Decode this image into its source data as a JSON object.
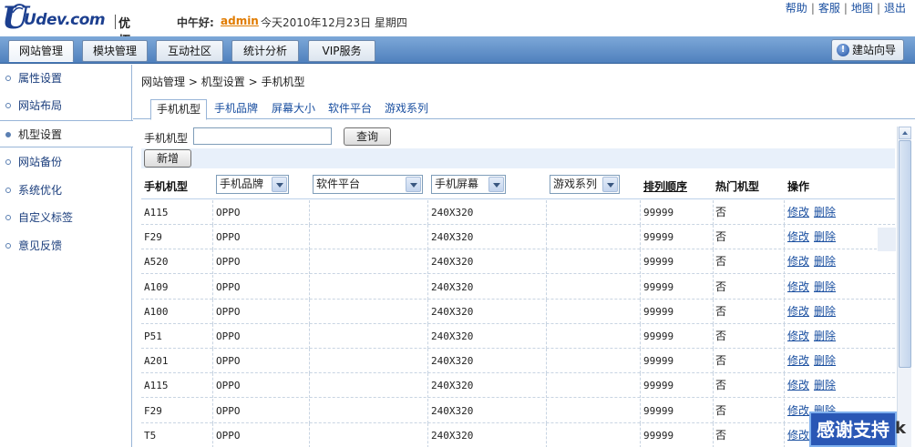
{
  "header": {
    "logo_text": "Udev.com",
    "logo_cn": "优拓",
    "greeting": "中午好:",
    "username": "admin",
    "date_text": "今天2010年12月23日 星期四",
    "top_links": [
      "帮助",
      "客服",
      "地图",
      "退出"
    ]
  },
  "nav": {
    "tabs": [
      "网站管理",
      "模块管理",
      "互动社区",
      "统计分析",
      "VIP服务"
    ],
    "active_tab": "网站管理",
    "wizard_label": "建站向导"
  },
  "sidebar": {
    "items": [
      "属性设置",
      "网站布局",
      "机型设置",
      "网站备份",
      "系统优化",
      "自定义标签",
      "意见反馈"
    ],
    "active": "机型设置"
  },
  "breadcrumb": [
    "网站管理",
    ">",
    "机型设置",
    ">",
    "手机机型"
  ],
  "subtabs": {
    "items": [
      "手机机型",
      "手机品牌",
      "屏幕大小",
      "软件平台",
      "游戏系列"
    ],
    "active": "手机机型"
  },
  "search": {
    "label": "手机机型",
    "value": "",
    "button": "查询"
  },
  "add_button": "新增",
  "table": {
    "col_model": "手机机型",
    "filter_brand": "手机品牌",
    "filter_platform": "软件平台",
    "filter_screen": "手机屏幕",
    "filter_game": "游戏系列",
    "col_order": "排列顺序",
    "col_hot": "热门机型",
    "col_ops": "操作",
    "action_edit": "修改",
    "action_delete": "删除",
    "rows": [
      {
        "model": "A115",
        "brand": "OPPO",
        "platform": "",
        "screen": "240X320",
        "game": "",
        "order": "99999",
        "hot": "否"
      },
      {
        "model": "F29",
        "brand": "OPPO",
        "platform": "",
        "screen": "240X320",
        "game": "",
        "order": "99999",
        "hot": "否"
      },
      {
        "model": "A520",
        "brand": "OPPO",
        "platform": "",
        "screen": "240X320",
        "game": "",
        "order": "99999",
        "hot": "否"
      },
      {
        "model": "A109",
        "brand": "OPPO",
        "platform": "",
        "screen": "240X320",
        "game": "",
        "order": "99999",
        "hot": "否"
      },
      {
        "model": "A100",
        "brand": "OPPO",
        "platform": "",
        "screen": "240X320",
        "game": "",
        "order": "99999",
        "hot": "否"
      },
      {
        "model": "P51",
        "brand": "OPPO",
        "platform": "",
        "screen": "240X320",
        "game": "",
        "order": "99999",
        "hot": "否"
      },
      {
        "model": "A201",
        "brand": "OPPO",
        "platform": "",
        "screen": "240X320",
        "game": "",
        "order": "99999",
        "hot": "否"
      },
      {
        "model": "A115",
        "brand": "OPPO",
        "platform": "",
        "screen": "240X320",
        "game": "",
        "order": "99999",
        "hot": "否"
      },
      {
        "model": "F29",
        "brand": "OPPO",
        "platform": "",
        "screen": "240X320",
        "game": "",
        "order": "99999",
        "hot": "否"
      },
      {
        "model": "T5",
        "brand": "OPPO",
        "platform": "",
        "screen": "240X320",
        "game": "",
        "order": "99999",
        "hot": "否"
      }
    ]
  },
  "badge": {
    "text": "感谢支持",
    "tail": "k"
  },
  "icons": {
    "wizard": "info-globe-icon",
    "sidebar_bullet": "bullet-circle-icon",
    "dropdown": "chevron-down-icon",
    "scroll_up": "scroll-up-arrow-icon"
  },
  "colors": {
    "nav_gradient_top": "#7da8d8",
    "nav_gradient_bottom": "#4f80bd",
    "link": "#1a4fa0",
    "username": "#e07b00",
    "badge_bg": "#2a57b5"
  }
}
